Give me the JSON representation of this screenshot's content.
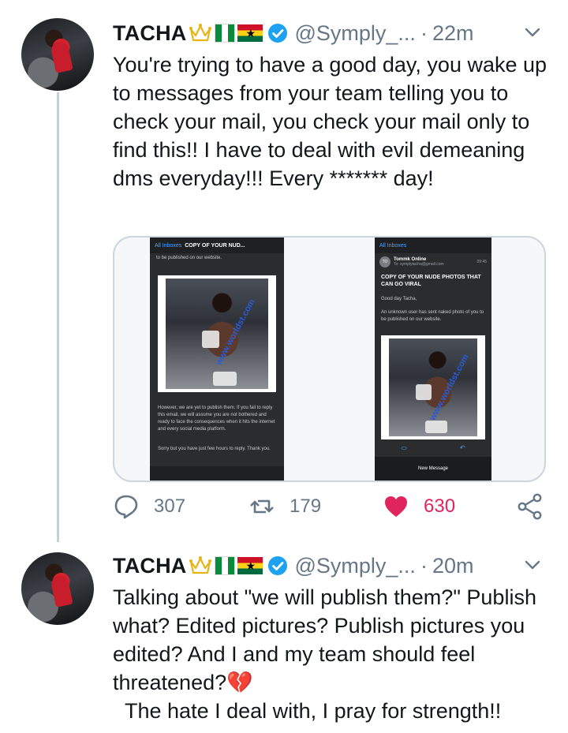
{
  "tweets": [
    {
      "name": "TACHA",
      "handle": "@Symply_...",
      "separator": "·",
      "time": "22m",
      "text": "You're trying to have a good day, you wake up to messages from your team telling you to check your mail, you check your mail only to find this!! I have to deal with evil demeaning dms everyday!!! Every ******* day!",
      "media": {
        "left_screen": {
          "back_label": "All Inboxes",
          "subject": "COPY OF YOUR NUD...",
          "top_line": "to be published on our website.",
          "watermark": "www.worldst.com",
          "body": "However, we are yet to publish them. If you fail to reply this email, we will assume you are not bothered and ready to face the consequences when it hits the internet and every social media platform.",
          "footer": "Sorry but you have just few hours to reply. Thank you."
        },
        "right_screen": {
          "back_label": "All Inboxes",
          "avatar_initials": "TO",
          "sender": "Tommk Online",
          "to_line": "To: symplytacha@gmail.com",
          "time": "09:45",
          "subject": "COPY OF YOUR NUDE PHOTOS THAT CAN GO VIRAL",
          "greeting": "Good day Tacha,",
          "line": "An unknown user has sent naked photo of you to be published on our website.",
          "watermark": "www.worldst.com",
          "bottom_label": "New Message"
        }
      },
      "replies": "307",
      "retweets": "179",
      "likes": "630"
    },
    {
      "name": "TACHA",
      "handle": "@Symply_...",
      "separator": "·",
      "time": "20m",
      "text": "Talking about \"we will publish them?\" Publish what? Edited pictures? Publish pictures you edited? And I and my team should feel threatened?💔\n  The hate I deal with, I pray for strength!!"
    }
  ],
  "colors": {
    "verified": "#1da1f2",
    "like": "#e0245e",
    "muted": "#657786",
    "thread_line": "#c4cfd6"
  },
  "icons": [
    "crown-icon",
    "nigeria-flag-icon",
    "ghana-flag-icon",
    "verified-badge-icon",
    "chevron-down-icon",
    "reply-icon",
    "retweet-icon",
    "heart-icon",
    "share-icon"
  ]
}
